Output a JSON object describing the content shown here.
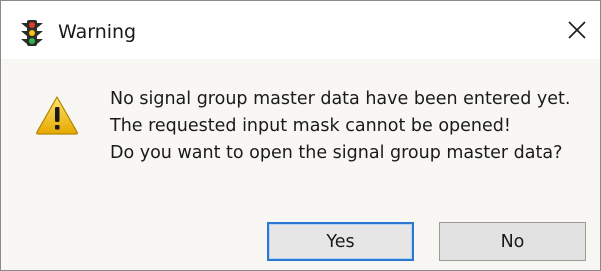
{
  "window": {
    "title": "Warning",
    "title_icon": "traffic-light-icon",
    "close_icon": "close-icon",
    "close_glyph": "✕"
  },
  "message": {
    "icon": "warning-triangle-icon",
    "lines": [
      "No signal group master data have been entered yet.",
      "The requested input mask cannot be opened!",
      "Do you want to open the signal group master data?"
    ]
  },
  "buttons": {
    "yes_label": "Yes",
    "no_label": "No",
    "default": "yes"
  },
  "colors": {
    "focus_border": "#2b78d0",
    "warning_yellow": "#f2c300",
    "traffic_light_body": "#2c2c2c",
    "traffic_light_red": "#e03a2b",
    "traffic_light_yellow": "#f3c414",
    "traffic_light_green": "#2fb34a"
  }
}
